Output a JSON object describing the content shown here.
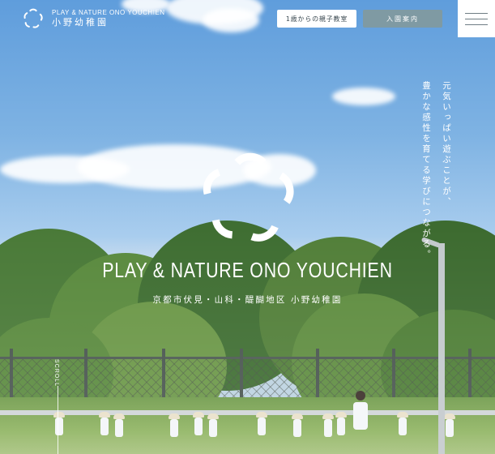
{
  "header": {
    "logo_en": "PLAY & NATURE ONO YOUCHIEN",
    "logo_ja": "小野幼稚園",
    "btn_trial": "1歳からの親子教室",
    "btn_admission": "入園案内"
  },
  "hero": {
    "vertical_line_1": "元気いっぱい遊ぶことが、",
    "vertical_line_2": "豊かな感性を育てる学びにつながる。",
    "brand_en": "PLAY & NATURE ONO YOUCHIEN",
    "brand_ja": "京都市伏見・山科・醍醐地区 小野幼稚園",
    "scroll": "SCROLL"
  },
  "colors": {
    "sky_top": "#5f9ddc",
    "button_admission": "#7f9aa3",
    "button_trial_text": "#3c4a52"
  },
  "icons": {
    "logo": "flower-logo-icon",
    "menu": "hamburger-menu-icon"
  }
}
